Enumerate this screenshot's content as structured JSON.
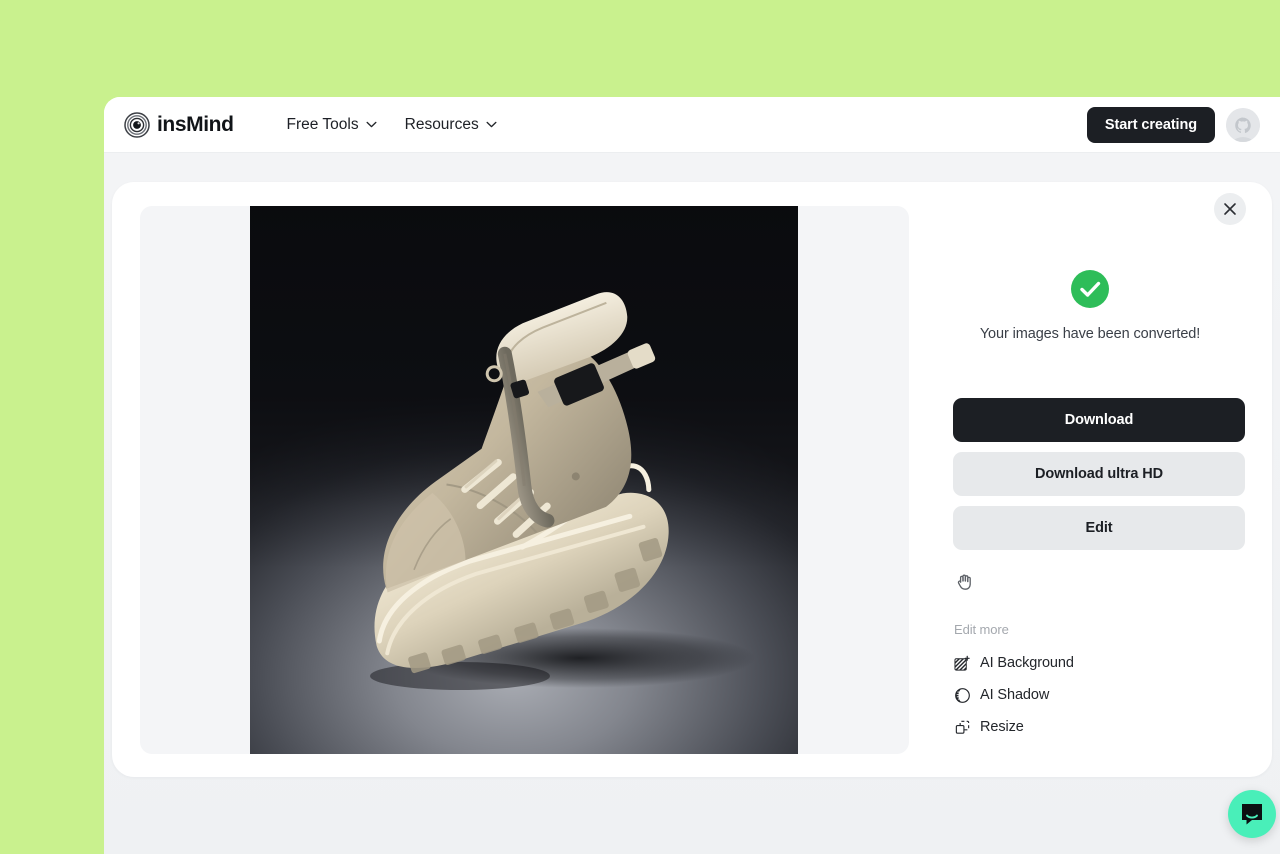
{
  "theme": {
    "page_background": "#c9f18e",
    "accent_dark": "#1c1f24",
    "success_green": "#2ebd59",
    "chat_green": "#49efb9",
    "panel_grey": "#e7e9eb"
  },
  "header": {
    "brand_name": "insMind",
    "brand_logo_icon": "concentric-rings-icon",
    "nav": [
      {
        "label": "Free Tools",
        "icon": "chevron-down-icon"
      },
      {
        "label": "Resources",
        "icon": "chevron-down-icon"
      }
    ],
    "cta_label": "Start creating",
    "avatar_icon": "user-avatar-octocat-icon"
  },
  "modal": {
    "close_icon": "close-icon",
    "preview": {
      "image_alt": "beige high-top sneaker boot on dark studio backdrop"
    },
    "status": {
      "icon": "success-check-circle-icon",
      "message": "Your images have been converted!"
    },
    "actions": [
      {
        "label": "Download",
        "style": "primary"
      },
      {
        "label": "Download ultra HD",
        "style": "secondary"
      },
      {
        "label": "Edit",
        "style": "secondary"
      }
    ],
    "tools": {
      "pan_icon": "hand-grab-icon"
    },
    "edit_more": {
      "label": "Edit more",
      "items": [
        {
          "label": "AI Background",
          "icon": "ai-background-icon"
        },
        {
          "label": "AI Shadow",
          "icon": "ai-shadow-icon"
        },
        {
          "label": "Resize",
          "icon": "resize-icon"
        }
      ]
    }
  },
  "chat": {
    "icon": "chat-bubble-icon"
  }
}
